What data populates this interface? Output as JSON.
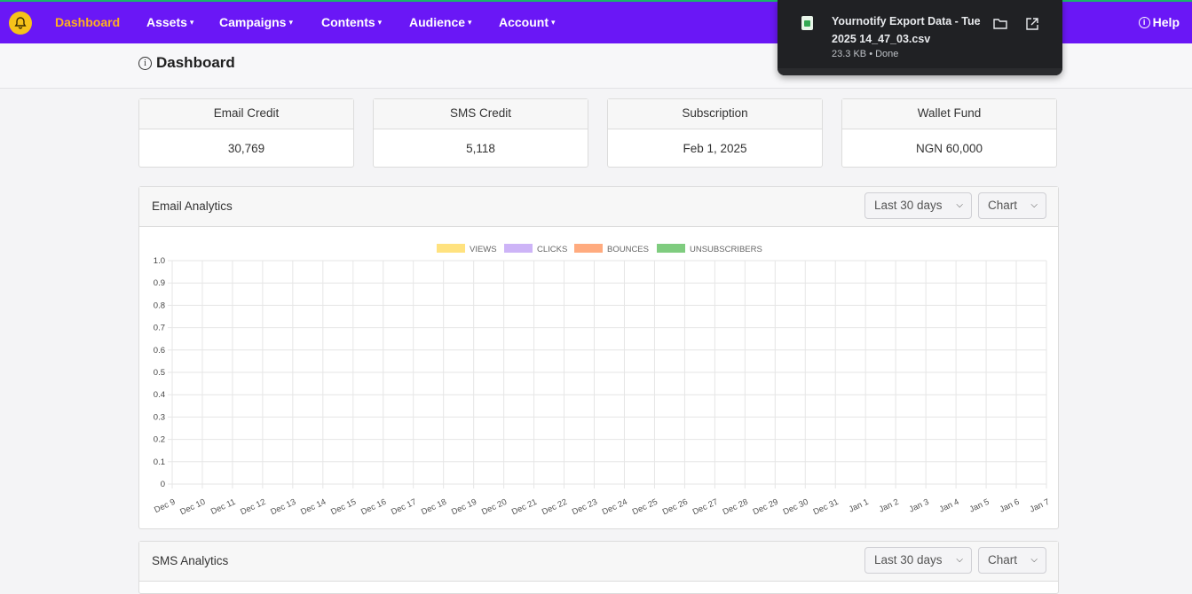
{
  "nav": {
    "items": [
      {
        "label": "Dashboard",
        "caret": false,
        "active": true
      },
      {
        "label": "Assets",
        "caret": true,
        "active": false
      },
      {
        "label": "Campaigns",
        "caret": true,
        "active": false
      },
      {
        "label": "Contents",
        "caret": true,
        "active": false
      },
      {
        "label": "Audience",
        "caret": true,
        "active": false
      },
      {
        "label": "Account",
        "caret": true,
        "active": false
      }
    ],
    "help_label": "Help",
    "accent_color": "#6a17f6",
    "active_color": "#ffb01f"
  },
  "page": {
    "title": "Dashboard"
  },
  "stats": [
    {
      "label": "Email Credit",
      "value": "30,769"
    },
    {
      "label": "SMS Credit",
      "value": "5,118"
    },
    {
      "label": "Subscription",
      "value": "Feb 1, 2025"
    },
    {
      "label": "Wallet Fund",
      "value": "NGN 60,000"
    }
  ],
  "email_panel": {
    "title": "Email Analytics",
    "range_select": "Last 30 days",
    "view_select": "Chart"
  },
  "sms_panel": {
    "title": "SMS Analytics",
    "range_select": "Last 30 days",
    "view_select": "Chart"
  },
  "download": {
    "filename": "Yournotify Export Data - Tue 2025 14_47_03.csv",
    "meta": "23.3 KB • Done"
  },
  "chart_data": {
    "type": "line",
    "title": "",
    "xlabel": "",
    "ylabel": "",
    "ylim": [
      0,
      1
    ],
    "yticks": [
      "1.0",
      "0.9",
      "0.8",
      "0.7",
      "0.6",
      "0.5",
      "0.4",
      "0.3",
      "0.2",
      "0.1",
      "0"
    ],
    "categories": [
      "Dec 9",
      "Dec 10",
      "Dec 11",
      "Dec 12",
      "Dec 13",
      "Dec 14",
      "Dec 15",
      "Dec 16",
      "Dec 17",
      "Dec 18",
      "Dec 19",
      "Dec 20",
      "Dec 21",
      "Dec 22",
      "Dec 23",
      "Dec 24",
      "Dec 25",
      "Dec 26",
      "Dec 27",
      "Dec 28",
      "Dec 29",
      "Dec 30",
      "Dec 31",
      "Jan 1",
      "Jan 2",
      "Jan 3",
      "Jan 4",
      "Jan 5",
      "Jan 6",
      "Jan 7"
    ],
    "series": [
      {
        "name": "VIEWS",
        "color": "#ffe27f",
        "values": []
      },
      {
        "name": "CLICKS",
        "color": "#cdb4f7",
        "values": []
      },
      {
        "name": "BOUNCES",
        "color": "#ffab7f",
        "values": []
      },
      {
        "name": "UNSUBSCRIBERS",
        "color": "#7fcc7f",
        "values": []
      }
    ],
    "grid": true,
    "legend_position": "top"
  }
}
